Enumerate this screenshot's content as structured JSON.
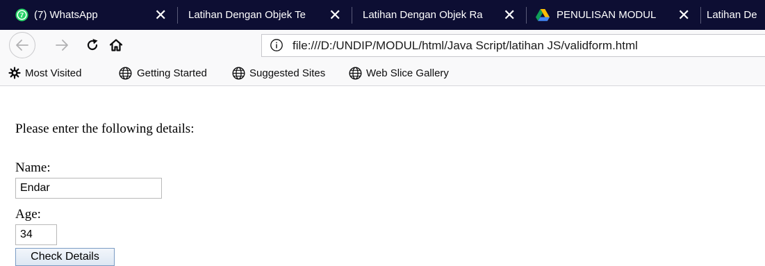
{
  "tabs": [
    {
      "title": "(7) WhatsApp",
      "favicon": "whatsapp-icon",
      "active": true
    },
    {
      "title": "Latihan Dengan Objek Te",
      "favicon": null
    },
    {
      "title": "Latihan Dengan Objek Ra",
      "favicon": null
    },
    {
      "title": "PENULISAN MODUL",
      "favicon": "google-drive-icon"
    },
    {
      "title": "Latihan De",
      "favicon": null
    }
  ],
  "tab_close_glyph": "✕",
  "address_bar": {
    "url": "file:///D:/UNDIP/MODUL/html/Java Script/latihan JS/validform.html"
  },
  "bookmarks": [
    {
      "label": "Most Visited",
      "icon": "gear-icon"
    },
    {
      "label": "Getting Started",
      "icon": "globe-icon"
    },
    {
      "label": "Suggested Sites",
      "icon": "globe-icon"
    },
    {
      "label": "Web Slice Gallery",
      "icon": "globe-icon"
    }
  ],
  "page": {
    "intro": "Please enter the following details:",
    "name_label": "Name:",
    "name_value": "Endar",
    "age_label": "Age:",
    "age_value": "34",
    "button_label": "Check Details"
  },
  "colors": {
    "tabstrip_bg": "#0d0e33",
    "whatsapp_green": "#25d366",
    "toolbar_bg": "#f9f9fa"
  }
}
